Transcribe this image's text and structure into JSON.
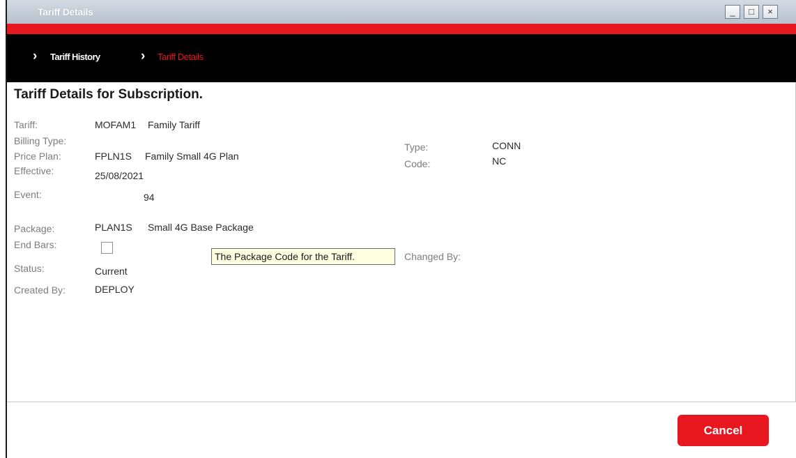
{
  "window": {
    "title": "Tariff Details",
    "minimize": "_",
    "maximize": "□",
    "close": "×"
  },
  "breadcrumb": {
    "items": [
      {
        "label": "Tariff History",
        "color": "#ffffff"
      },
      {
        "label": "Tariff Details",
        "color": "#e8161f"
      }
    ],
    "separator": "›"
  },
  "heading": "Tariff Details for Subscription.",
  "fields": {
    "tariff": {
      "label": "Tariff:",
      "code": "MOFAM1",
      "name": "Family Tariff"
    },
    "billing_type": {
      "label": "Billing Type:",
      "value": ""
    },
    "price_plan": {
      "label": "Price Plan:",
      "code": "FPLN1S",
      "name": "Family Small 4G Plan"
    },
    "effective": {
      "label": "Effective:",
      "value": "25/08/2021"
    },
    "event": {
      "label": "Event:",
      "value": "94"
    },
    "type": {
      "label": "Type:",
      "value": "CONN"
    },
    "code": {
      "label": "Code:",
      "value": "NC"
    },
    "package": {
      "label": "Package:",
      "code": "PLAN1S",
      "name": "Small 4G Base Package"
    },
    "end_bars": {
      "label": "End Bars:",
      "checked": false
    },
    "status": {
      "label": "Status:",
      "value": "Current"
    },
    "created_by": {
      "label": "Created By:",
      "value": "DEPLOY"
    },
    "changed_by": {
      "label": "Changed By:",
      "value": ""
    }
  },
  "tooltip": "The Package Code for the Tariff.",
  "footer": {
    "cancel_label": "Cancel"
  },
  "colors": {
    "accent_red": "#e8161f",
    "nav_black": "#000000",
    "label_gray": "#7d7d7d"
  }
}
